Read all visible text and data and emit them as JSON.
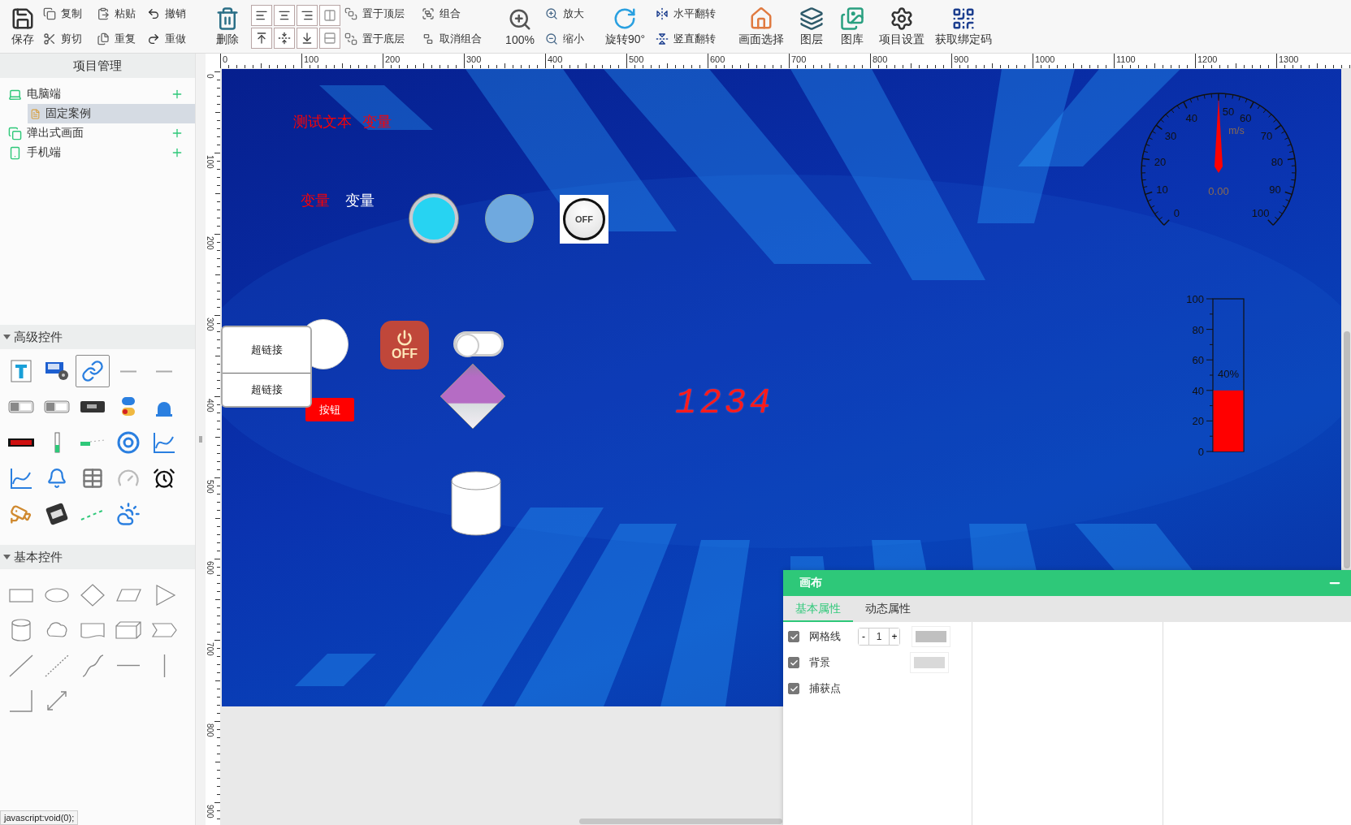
{
  "toolbar": {
    "groups": [
      {
        "kind": "large",
        "items": [
          "保存"
        ]
      },
      {
        "kind": "pair",
        "items": [
          "复制",
          "剪切"
        ]
      },
      {
        "kind": "pair",
        "items": [
          "粘贴",
          "重复"
        ]
      },
      {
        "kind": "pair",
        "items": [
          "撤销",
          "重做"
        ]
      },
      {
        "kind": "large",
        "items": [
          "删除"
        ]
      },
      {
        "kind": "align"
      },
      {
        "kind": "pair",
        "items": [
          "置于顶层",
          "置于底层"
        ]
      },
      {
        "kind": "pair",
        "items": [
          "组合",
          "取消组合"
        ]
      },
      {
        "kind": "large",
        "items": [
          "100%"
        ]
      },
      {
        "kind": "pair",
        "items": [
          "放大",
          "缩小"
        ]
      },
      {
        "kind": "large",
        "items": [
          "旋转90°"
        ]
      },
      {
        "kind": "pair",
        "items": [
          "水平翻转",
          "竖直翻转"
        ]
      },
      {
        "kind": "large",
        "items": [
          "画面选择"
        ]
      },
      {
        "kind": "large",
        "items": [
          "图层"
        ]
      },
      {
        "kind": "large",
        "items": [
          "图库"
        ]
      },
      {
        "kind": "large",
        "items": [
          "项目设置"
        ]
      },
      {
        "kind": "large",
        "items": [
          "获取绑定码"
        ]
      }
    ]
  },
  "sidebar": {
    "title": "项目管理",
    "tree": [
      {
        "label": "电脑端",
        "add": true,
        "selected": false,
        "children": [
          {
            "label": "固定案例",
            "selected": true
          }
        ]
      },
      {
        "label": "弹出式画面",
        "add": true,
        "selected": false
      },
      {
        "label": "手机端",
        "add": true,
        "selected": false
      }
    ],
    "sections": [
      {
        "title": "高级控件",
        "expanded": true
      },
      {
        "title": "基本控件",
        "expanded": true
      }
    ],
    "palette": [
      {
        "selected": false
      },
      {
        "selected": false
      },
      {
        "selected": true
      },
      {
        "selected": false
      },
      {
        "selected": false
      },
      {
        "selected": false
      },
      {
        "selected": false
      },
      {
        "selected": false
      },
      {
        "selected": false
      },
      {
        "selected": false
      },
      {
        "selected": false
      },
      {
        "selected": false
      },
      {
        "selected": false
      },
      {
        "selected": false
      },
      {
        "selected": false
      },
      {
        "selected": false
      },
      {
        "selected": false
      },
      {
        "selected": false
      },
      {
        "selected": false
      },
      {
        "selected": false
      },
      {
        "selected": false
      },
      {
        "selected": false
      },
      {
        "selected": false
      },
      {
        "selected": false
      }
    ]
  },
  "rulers": {
    "x_labels": [
      "0",
      "100",
      "200",
      "300",
      "400",
      "500",
      "600",
      "700",
      "800",
      "900",
      "1000",
      "1100",
      "1200",
      "1300"
    ],
    "y_labels": [
      "0",
      "100",
      "200",
      "300",
      "400",
      "500",
      "600",
      "700",
      "800",
      "900"
    ]
  },
  "canvas": {
    "texts": [
      {
        "text": "测试文本",
        "color": "#ff0000"
      },
      {
        "text": "变量",
        "color": "#ff0000"
      },
      {
        "text": "变量",
        "color": "#ff0000"
      },
      {
        "text": "变量",
        "color": "#ffffff"
      }
    ],
    "knob": {
      "label": "OFF",
      "on": false
    },
    "power_button": {
      "label": "OFF"
    },
    "toggle": {
      "on": false
    },
    "button": {
      "label": "按钮"
    },
    "digital_display": {
      "value": "1234"
    },
    "gauge": {
      "unit": "m/s",
      "reading": "0.00",
      "level": 0.5,
      "ticks": [
        "0",
        "10",
        "20",
        "30",
        "40",
        "50",
        "60",
        "70",
        "80",
        "90",
        "100"
      ]
    },
    "tank": {
      "level": 0.4,
      "reading": "40%",
      "ticks": [
        "100",
        "80",
        "60",
        "40",
        "20",
        "0"
      ]
    }
  },
  "popup_menu": {
    "items": [
      "超链接",
      "超链接"
    ]
  },
  "properties": {
    "title": "画布",
    "tabs": [
      {
        "label": "基本属性",
        "selected": true
      },
      {
        "label": "动态属性",
        "selected": false
      }
    ],
    "rows": [
      {
        "label": "网格线",
        "checked": true,
        "stepper": {
          "minus": "-",
          "value": "1",
          "plus": "+"
        },
        "swatch": true
      },
      {
        "label": "背景",
        "checked": true,
        "swatch": true
      },
      {
        "label": "捕获点",
        "checked": true
      }
    ]
  },
  "status_text": "javascript:void(0);"
}
